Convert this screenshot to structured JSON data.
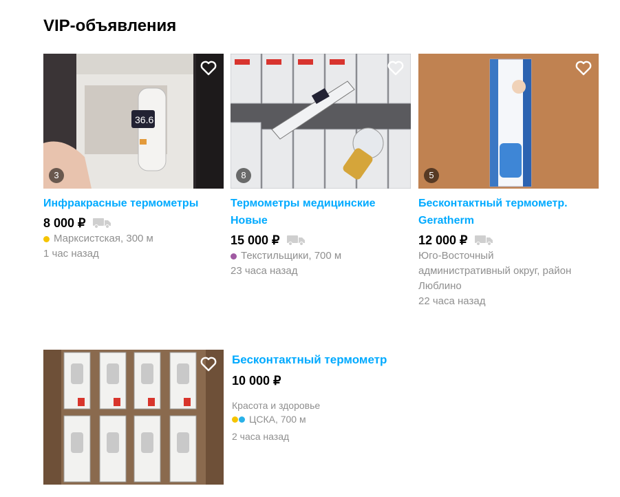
{
  "section": {
    "title": "VIP-объявления"
  },
  "colors": {
    "link": "#00aaff",
    "heart": "#ffffff",
    "muted": "#8f8f8f"
  },
  "cards": [
    {
      "title": "Инфракрасные термометры",
      "price": "8 000 ₽",
      "photo_count": "3",
      "metro": "Марксистская, 300 м",
      "metro_color": "#f5c400",
      "time": "1 час назад"
    },
    {
      "title": "Термометры медицинские Новые",
      "price": "15 000 ₽",
      "photo_count": "8",
      "metro": "Текстильщики, 700 м",
      "metro_color": "#a05aa2",
      "time": "23 часа назад"
    },
    {
      "title": "Бесконтактный термометр. Geratherm",
      "price": "12 000 ₽",
      "photo_count": "5",
      "location": "Юго-Восточный административный округ, район Люблино",
      "time": "22 часа назад"
    },
    {
      "title": "Бесконтактный термометр",
      "price": "10 000 ₽",
      "category": "Красота и здоровье",
      "metro": "ЦСКА, 700 м",
      "metro_colors": [
        "#f5c400",
        "#29b1e8"
      ],
      "time": "2 часа назад"
    }
  ]
}
